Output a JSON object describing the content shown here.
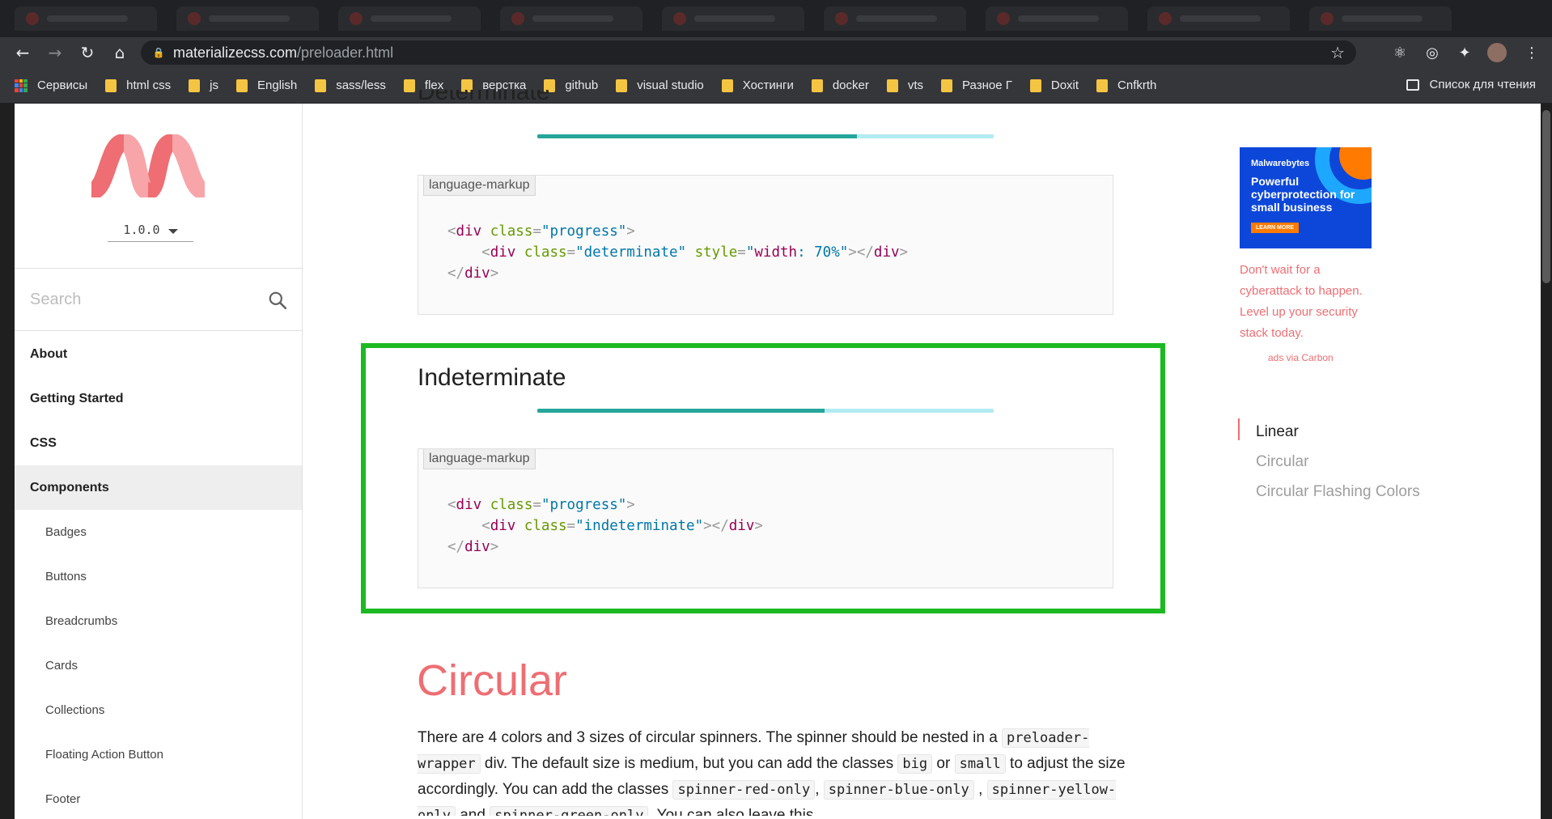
{
  "browser": {
    "url_host": "materializecss.com",
    "url_path": "/preloader.html",
    "bookmarks": [
      "Сервисы",
      "html css",
      "js",
      "English",
      "sass/less",
      "flex",
      "верстка",
      "github",
      "visual studio",
      "Хостинги",
      "docker",
      "vts",
      "Разное Г",
      "Doxit",
      "Cnfkrth"
    ],
    "reading_list": "Список для чтения"
  },
  "sidebar": {
    "version": "1.0.0",
    "search_placeholder": "Search",
    "nav": [
      "About",
      "Getting Started",
      "CSS",
      "Components"
    ],
    "active_nav": "Components",
    "sub_items": [
      "Badges",
      "Buttons",
      "Breadcrumbs",
      "Cards",
      "Collections",
      "Floating Action Button",
      "Footer"
    ]
  },
  "main": {
    "partial_heading": "Determinate",
    "determinate_progress": 0.7,
    "code_label": "language-markup",
    "indeterminate_heading": "Indeterminate",
    "indeterminate_progress": 0.63,
    "circular_heading": "Circular",
    "para": {
      "t1": "There are 4 colors and 3 sizes of circular spinners. The spinner should be nested in a ",
      "c1": "preloader-wrapper",
      "t2": " div. The default size is medium, but you can add the classes ",
      "c2": "big",
      "t3": " or ",
      "c3": "small",
      "t4": " to adjust the size accordingly. You can add the classes ",
      "c4": "spinner-red-only",
      "t5": ",",
      "c5": "spinner-blue-only",
      "t6": " , ",
      "c6": "spinner-yellow-only",
      "t7": " and ",
      "c7": "spinner-green-only",
      "t8": ". You can also leave this"
    }
  },
  "ad": {
    "brand": "Malwarebytes",
    "headline": "Powerful cyberprotection for small business",
    "cta": "LEARN MORE",
    "text": "Don't wait for a cyberattack to happen. Level up your security stack today.",
    "via": "ads via Carbon"
  },
  "toc": {
    "items": [
      "Linear",
      "Circular",
      "Circular Flashing Colors"
    ],
    "active": "Linear"
  },
  "colors": {
    "accent": "#ee6e73",
    "progress_fill": "#26a69a",
    "progress_track": "#b2ebf2",
    "highlight": "#1db922"
  }
}
